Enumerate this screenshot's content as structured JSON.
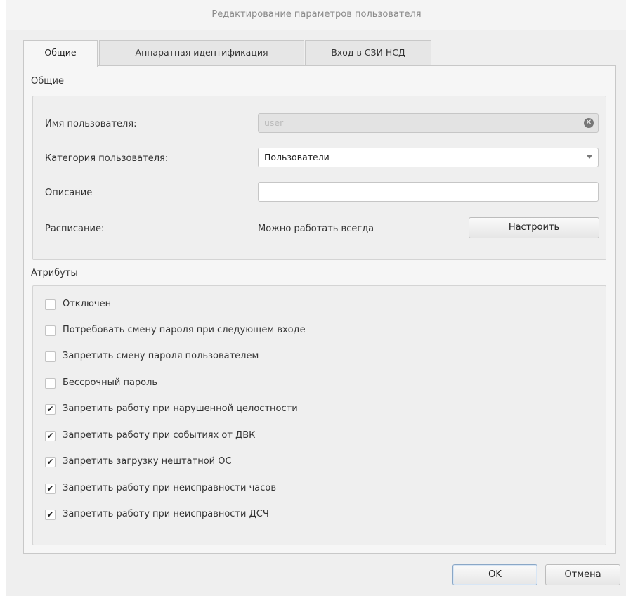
{
  "window": {
    "title": "Редактирование параметров пользователя"
  },
  "tabs": [
    {
      "label": "Общие",
      "active": true
    },
    {
      "label": "Аппаратная идентификация",
      "active": false
    },
    {
      "label": "Вход в СЗИ НСД",
      "active": false
    }
  ],
  "general": {
    "section_title": "Общие",
    "username_label": "Имя пользователя:",
    "username_value": "user",
    "category_label": "Категория пользователя:",
    "category_value": "Пользователи",
    "description_label": "Описание",
    "description_value": "",
    "schedule_label": "Расписание:",
    "schedule_value": "Можно работать всегда",
    "configure_button": "Настроить"
  },
  "attributes": {
    "section_title": "Атрибуты",
    "items": [
      {
        "label": "Отключен",
        "checked": false
      },
      {
        "label": "Потребовать смену пароля при следующем входе",
        "checked": false
      },
      {
        "label": "Запретить смену пароля пользователем",
        "checked": false
      },
      {
        "label": "Бессрочный пароль",
        "checked": false
      },
      {
        "label": "Запретить работу при нарушенной целостности",
        "checked": true
      },
      {
        "label": "Запретить работу при событиях от ДВК",
        "checked": true
      },
      {
        "label": "Запретить загрузку нештатной ОС",
        "checked": true
      },
      {
        "label": "Запретить работу при неисправности часов",
        "checked": true
      },
      {
        "label": "Запретить работу при неисправности ДСЧ",
        "checked": true
      }
    ]
  },
  "footer": {
    "ok_label": "OK",
    "cancel_label": "Отмена"
  },
  "icons": {
    "clear": "clear-icon",
    "dropdown": "chevron-down-icon",
    "check": "checkmark-icon"
  }
}
